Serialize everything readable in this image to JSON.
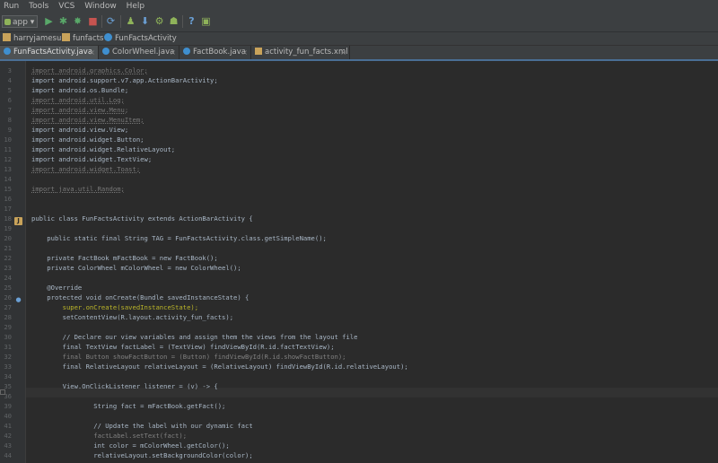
{
  "menu": [
    "Run",
    "Tools",
    "VCS",
    "Window",
    "Help"
  ],
  "toolbar": {
    "run_config": "app ▾",
    "icons": [
      "run-icon",
      "debug-icon",
      "attach-debugger-icon",
      "stop-icon",
      "sync-icon",
      "avd-manager-icon",
      "sdk-manager-icon",
      "android-device-icon",
      "help-icon",
      "ddms-icon"
    ]
  },
  "breadcrumb": [
    "harryjamesuk",
    "funfacts",
    "FunFactsActivity"
  ],
  "tabs": [
    "FunFactsActivity.java",
    "ColorWheel.java",
    "FactBook.java",
    "activity_fun_facts.xml"
  ],
  "code_lines": [
    {
      "n": "3",
      "t": "import android.graphics.Color;"
    },
    {
      "n": "4",
      "t": "import android.support.v7.app.ActionBarActivity;"
    },
    {
      "n": "5",
      "t": "import android.os.Bundle;"
    },
    {
      "n": "6",
      "t": "import android.util.Log;"
    },
    {
      "n": "7",
      "t": "import android.view.Menu;"
    },
    {
      "n": "8",
      "t": "import android.view.MenuItem;"
    },
    {
      "n": "9",
      "t": "import android.view.View;"
    },
    {
      "n": "10",
      "t": "import android.widget.Button;"
    },
    {
      "n": "11",
      "t": "import android.widget.RelativeLayout;"
    },
    {
      "n": "12",
      "t": "import android.widget.TextView;"
    },
    {
      "n": "13",
      "t": "import android.widget.Toast;"
    },
    {
      "n": "14",
      "t": ""
    },
    {
      "n": "15",
      "t": "import java.util.Random;"
    },
    {
      "n": "16",
      "t": ""
    },
    {
      "n": "17",
      "t": ""
    },
    {
      "n": "18",
      "t": "public class FunFactsActivity extends ActionBarActivity {"
    },
    {
      "n": "19",
      "t": ""
    },
    {
      "n": "20",
      "t": "    public static final String TAG = FunFactsActivity.class.getSimpleName();"
    },
    {
      "n": "21",
      "t": ""
    },
    {
      "n": "22",
      "t": "    private FactBook mFactBook = new FactBook();"
    },
    {
      "n": "23",
      "t": "    private ColorWheel mColorWheel = new ColorWheel();"
    },
    {
      "n": "24",
      "t": ""
    },
    {
      "n": "25",
      "t": "    @Override"
    },
    {
      "n": "26",
      "t": "    protected void onCreate(Bundle savedInstanceState) {"
    },
    {
      "n": "27",
      "t": "        super.onCreate(savedInstanceState);"
    },
    {
      "n": "28",
      "t": "        setContentView(R.layout.activity_fun_facts);"
    },
    {
      "n": "29",
      "t": ""
    },
    {
      "n": "30",
      "t": "        // Declare our view variables and assign them the views from the layout file"
    },
    {
      "n": "31",
      "t": "        final TextView factLabel = (TextView) findViewById(R.id.factTextView);"
    },
    {
      "n": "32",
      "t": "        final Button showFactButton = (Button) findViewById(R.id.showFactButton);"
    },
    {
      "n": "33",
      "t": "        final RelativeLayout relativeLayout = (RelativeLayout) findViewById(R.id.relativeLayout);"
    },
    {
      "n": "34",
      "t": ""
    },
    {
      "n": "35",
      "t": "        View.OnClickListener listener = (v) -> {"
    },
    {
      "n": "36",
      "t": ""
    },
    {
      "n": "39",
      "t": "                String fact = mFactBook.getFact();"
    },
    {
      "n": "40",
      "t": ""
    },
    {
      "n": "41",
      "t": "                // Update the label with our dynamic fact"
    },
    {
      "n": "42",
      "t": "                factLabel.setText(fact);"
    },
    {
      "n": "43",
      "t": "                int color = mColorWheel.getColor();"
    },
    {
      "n": "44",
      "t": "                relativeLayout.setBackgroundColor(color);"
    }
  ]
}
